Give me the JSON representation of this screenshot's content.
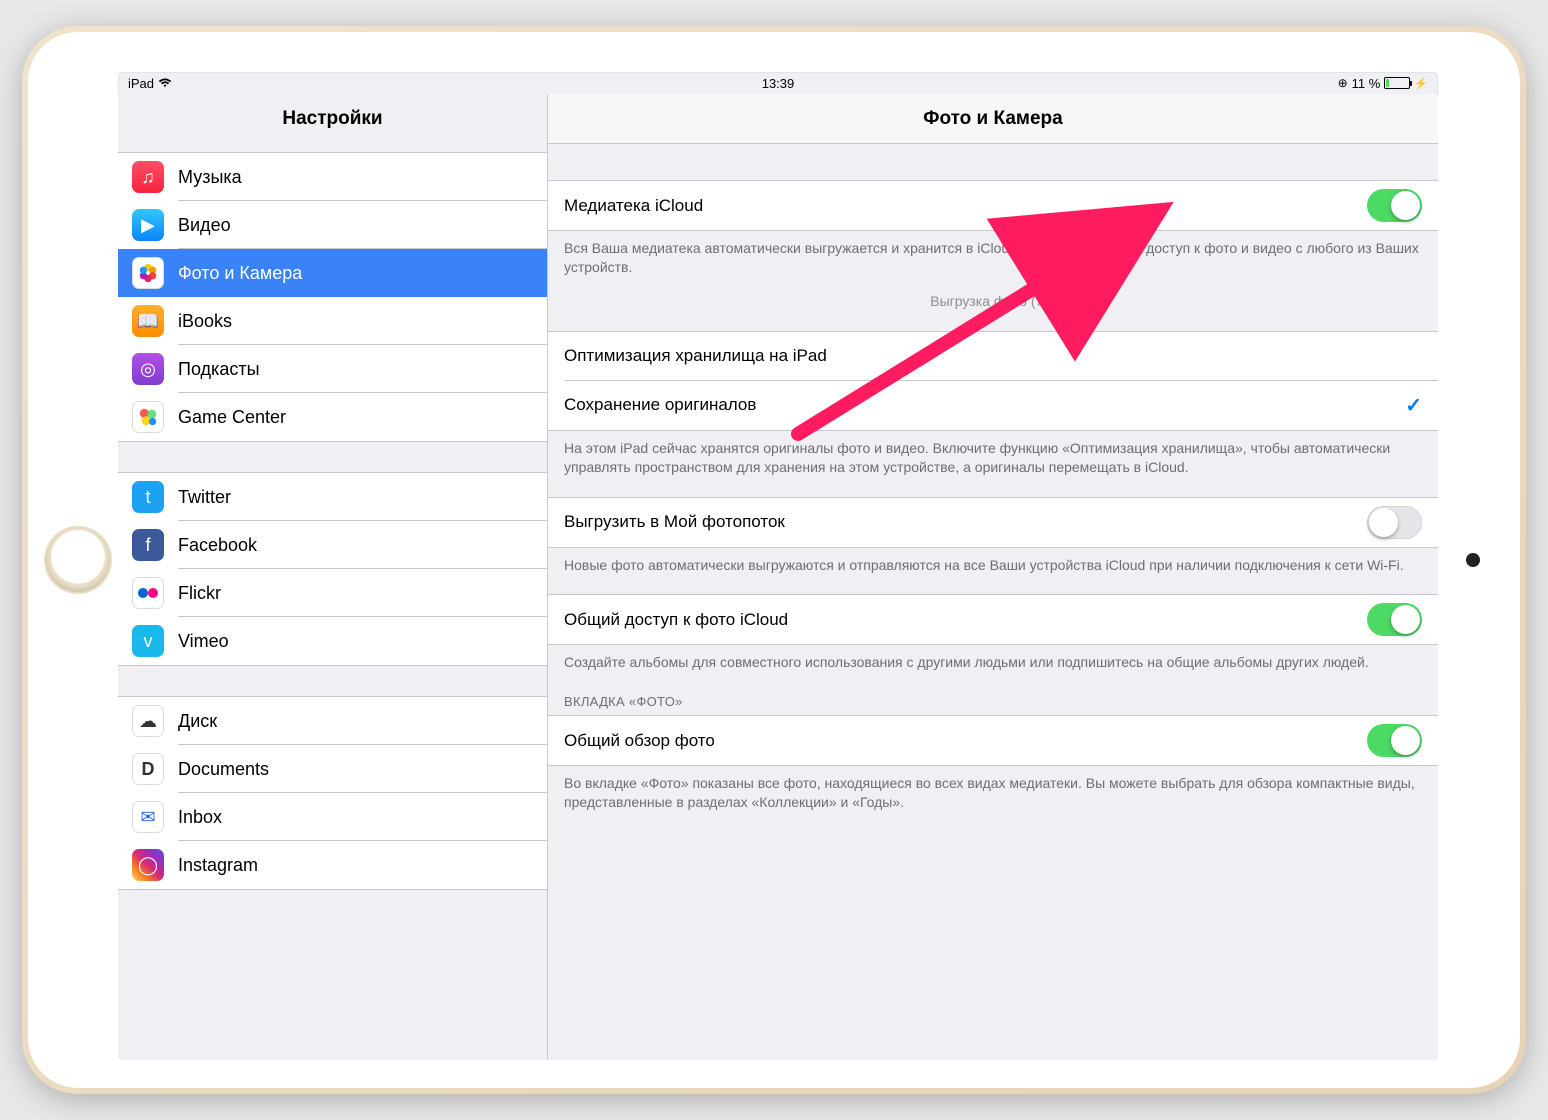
{
  "status": {
    "device": "iPad",
    "time": "13:39",
    "battery": "11 %"
  },
  "sidebar": {
    "title": "Настройки",
    "groups": [
      [
        {
          "label": "Музыка"
        },
        {
          "label": "Видео"
        },
        {
          "label": "Фото и Камера",
          "selected": true
        },
        {
          "label": "iBooks"
        },
        {
          "label": "Подкасты"
        },
        {
          "label": "Game Center"
        }
      ],
      [
        {
          "label": "Twitter"
        },
        {
          "label": "Facebook"
        },
        {
          "label": "Flickr"
        },
        {
          "label": "Vimeo"
        }
      ],
      [
        {
          "label": "Диск"
        },
        {
          "label": "Documents"
        },
        {
          "label": "Inbox"
        },
        {
          "label": "Instagram"
        }
      ]
    ]
  },
  "content": {
    "title": "Фото и Камера",
    "icloud_library_label": "Медиатека iCloud",
    "icloud_library_footer": "Вся Ваша медиатека автоматически выгружается и хранится в iCloud, чтобы обеспечить доступ к фото и видео с любого из Ваших устройств.",
    "upload_status": "Выгрузка фото (72)",
    "optimize_label": "Оптимизация хранилища на iPad",
    "keep_originals_label": "Сохранение оригиналов",
    "storage_footer": "На этом iPad сейчас хранятся оригиналы фото и видео. Включите функцию «Оптимизация хранилища», чтобы автоматически управлять пространством для хранения на этом устройстве, а оригиналы перемещать в iCloud.",
    "photostream_label": "Выгрузить в Мой фотопоток",
    "photostream_footer": "Новые фото автоматически выгружаются и отправляются на все Ваши устройства iCloud при наличии подключения к сети Wi-Fi.",
    "shared_label": "Общий доступ к фото iCloud",
    "shared_footer": "Создайте альбомы для совместного использования с другими людьми или подпишитесь на общие альбомы других людей.",
    "tab_header": "ВКЛАДКА «ФОТО»",
    "summary_label": "Общий обзор фото",
    "summary_footer": "Во вкладке «Фото» показаны все фото, находящиеся во всех видах медиатеки. Вы можете выбрать для обзора компактные виды, представленные в разделах «Коллекции» и «Годы»."
  }
}
